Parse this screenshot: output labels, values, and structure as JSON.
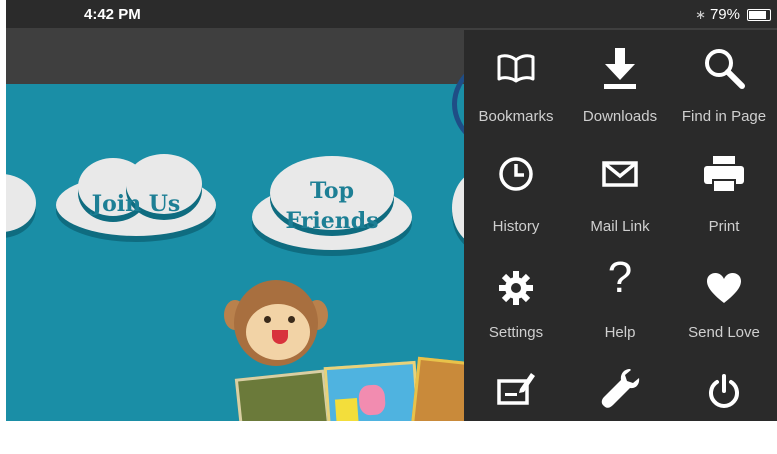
{
  "status_bar": {
    "time": "4:42 PM",
    "battery_percent": "79%",
    "battery_level": 0.79
  },
  "page": {
    "buttons": [
      {
        "text": "Join Us"
      },
      {
        "text": "Top Friends"
      }
    ]
  },
  "menu": {
    "items": [
      {
        "label": "Bookmarks",
        "icon": "book-icon"
      },
      {
        "label": "Downloads",
        "icon": "download-icon"
      },
      {
        "label": "Find in Page",
        "icon": "search-icon"
      },
      {
        "label": "History",
        "icon": "clock-icon"
      },
      {
        "label": "Mail Link",
        "icon": "envelope-icon"
      },
      {
        "label": "Print",
        "icon": "printer-icon"
      },
      {
        "label": "Settings",
        "icon": "gear-icon"
      },
      {
        "label": "Help",
        "icon": "question-icon"
      },
      {
        "label": "Send Love",
        "icon": "heart-icon"
      },
      {
        "label": "",
        "icon": "edit-icon"
      },
      {
        "label": "",
        "icon": "wrench-icon"
      },
      {
        "label": "",
        "icon": "power-icon"
      }
    ]
  },
  "colors": {
    "page_bg": "#1a8ea6",
    "menu_bg": "#2a2a2a",
    "highlight": "#1f4d86"
  }
}
